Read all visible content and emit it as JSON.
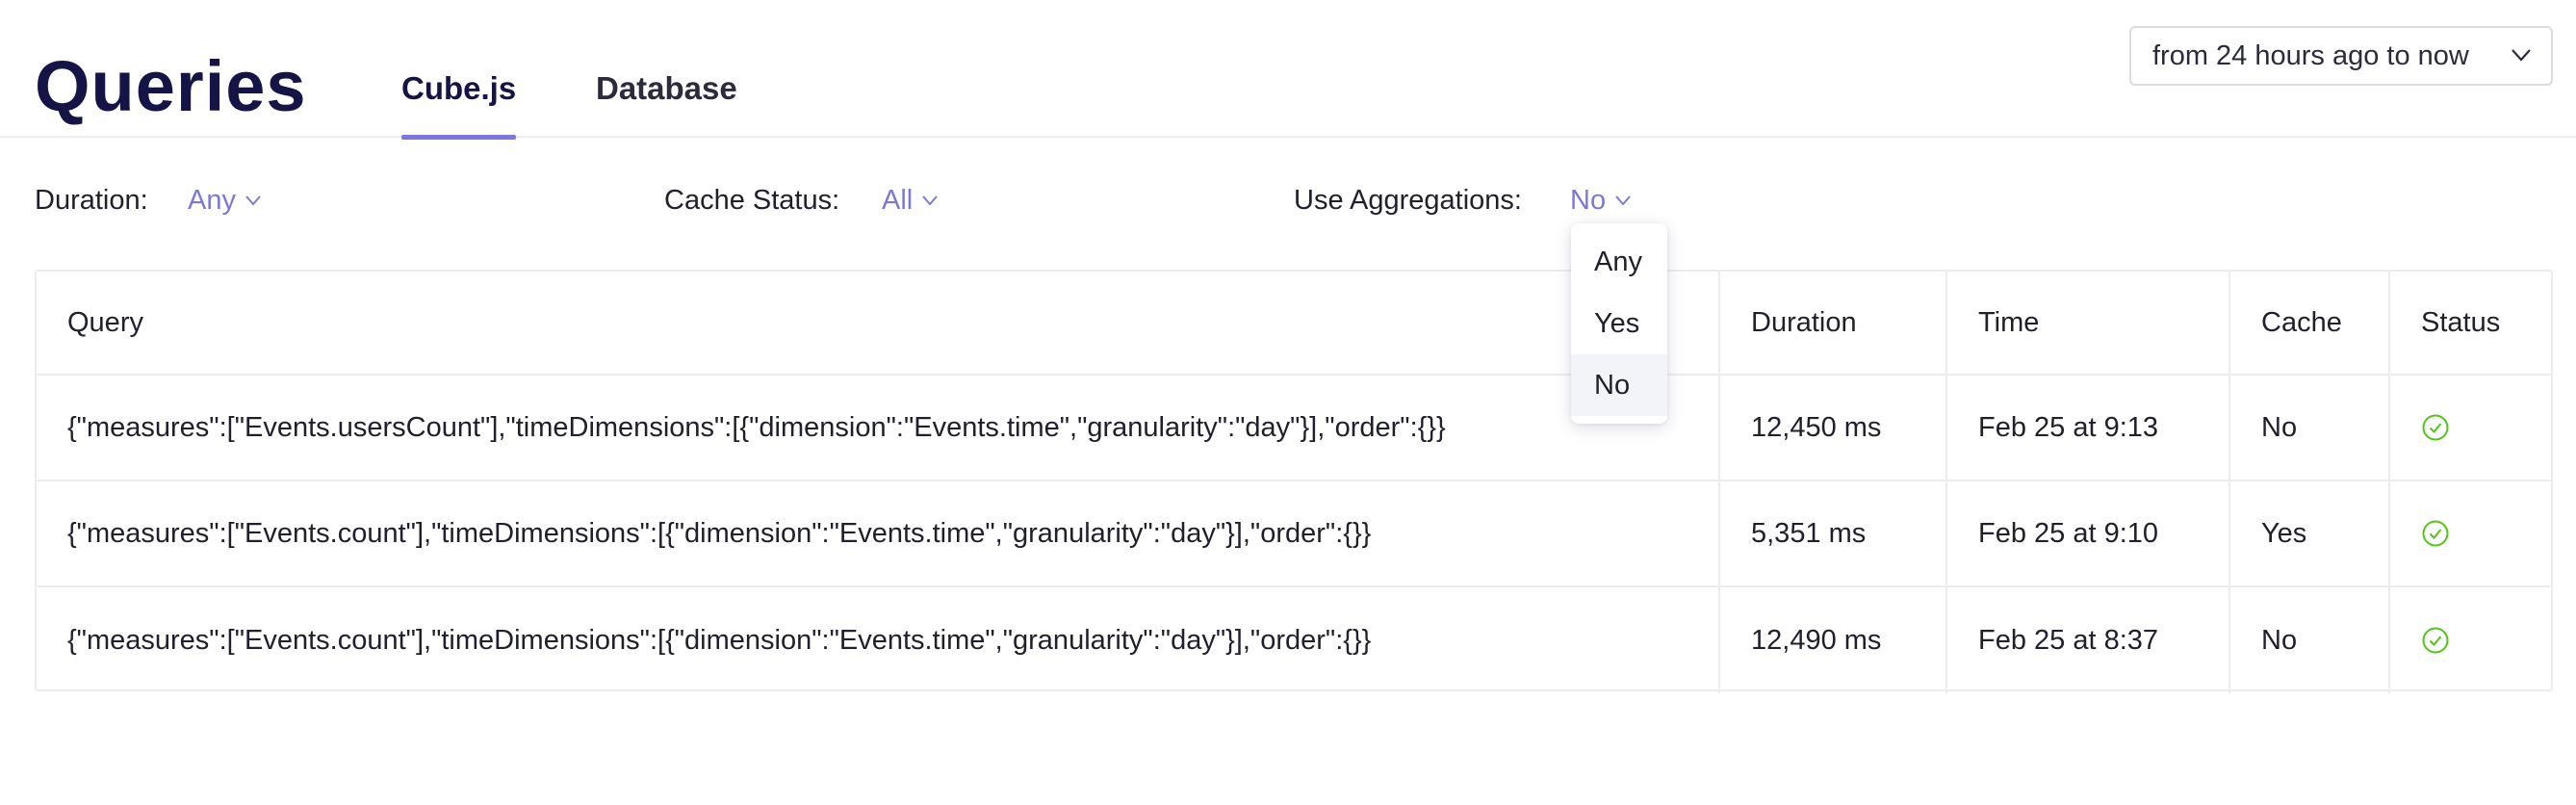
{
  "header": {
    "title": "Queries",
    "tabs": [
      {
        "label": "Cube.js",
        "active": true
      },
      {
        "label": "Database",
        "active": false
      }
    ],
    "time_range": "from 24 hours ago to now"
  },
  "filters": {
    "duration": {
      "label": "Duration:",
      "value": "Any"
    },
    "cache_status": {
      "label": "Cache Status:",
      "value": "All"
    },
    "use_aggregations": {
      "label": "Use Aggregations:",
      "value": "No"
    }
  },
  "dropdown": {
    "options": [
      "Any",
      "Yes",
      "No"
    ],
    "selected": "No"
  },
  "table": {
    "columns": [
      "Query",
      "Duration",
      "Time",
      "Cache",
      "Status"
    ],
    "rows": [
      {
        "query": "{\"measures\":[\"Events.usersCount\"],\"timeDimensions\":[{\"dimension\":\"Events.time\",\"granularity\":\"day\"}],\"order\":{}}",
        "duration": "12,450 ms",
        "time": "Feb 25 at 9:13",
        "cache": "No",
        "status": "success-check-icon"
      },
      {
        "query": "{\"measures\":[\"Events.count\"],\"timeDimensions\":[{\"dimension\":\"Events.time\",\"granularity\":\"day\"}],\"order\":{}}",
        "duration": "5,351 ms",
        "time": "Feb 25 at 9:10",
        "cache": "Yes",
        "status": "success-check-icon"
      },
      {
        "query": "{\"measures\":[\"Events.count\"],\"timeDimensions\":[{\"dimension\":\"Events.time\",\"granularity\":\"day\"}],\"order\":{}}",
        "duration": "12,490 ms",
        "time": "Feb 25 at 8:37",
        "cache": "No",
        "status": "success-check-icon"
      }
    ]
  },
  "colors": {
    "accent": "#7a77dd",
    "title": "#141446",
    "success": "#52c41a",
    "border": "#ececf0"
  }
}
